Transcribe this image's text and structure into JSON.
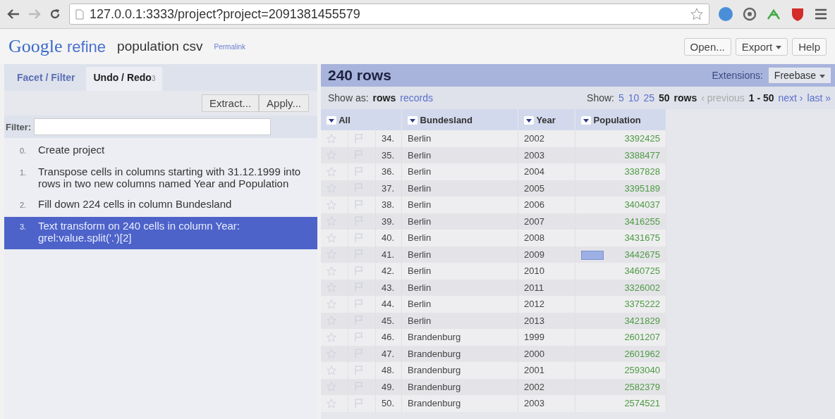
{
  "browser": {
    "url": "127.0.0.1:3333/project?project=2091381455579"
  },
  "header": {
    "logo_google": "Google",
    "logo_refine": "refine",
    "project_name": "population csv",
    "permalink": "Permalink",
    "buttons": [
      {
        "label": "Open...",
        "menu": false
      },
      {
        "label": "Export",
        "menu": true
      },
      {
        "label": "Help",
        "menu": false
      }
    ]
  },
  "left_panel": {
    "tabs": [
      {
        "label": "Facet / Filter",
        "selected": false
      },
      {
        "label": "Undo / Redo",
        "count": "3",
        "selected": true
      }
    ],
    "actions": [
      "Extract...",
      "Apply..."
    ],
    "filter_label": "Filter:",
    "history": [
      {
        "index": "0.",
        "text": "Create project",
        "selected": false
      },
      {
        "index": "1.",
        "text": "Transpose cells in columns starting with 31.12.1999 into rows in two new columns named Year and Population",
        "selected": false
      },
      {
        "index": "2.",
        "text": "Fill down 224 cells in column Bundesland",
        "selected": false
      },
      {
        "index": "3.",
        "text": "Text transform on 240 cells in column Year: grel:value.split('.')[2]",
        "selected": true
      }
    ]
  },
  "grid": {
    "row_count": "240 rows",
    "extensions_label": "Extensions:",
    "extension_menu": "Freebase",
    "show_as_label": "Show as:",
    "modes": [
      {
        "label": "rows",
        "selected": true
      },
      {
        "label": "records",
        "selected": false
      }
    ],
    "show_label": "Show:",
    "page_sizes": [
      {
        "label": "5",
        "selected": false
      },
      {
        "label": "10",
        "selected": false
      },
      {
        "label": "25",
        "selected": false
      },
      {
        "label": "50",
        "selected": true
      }
    ],
    "page_size_unit": "rows",
    "pager": {
      "previous": "‹ previous",
      "previous_disabled": true,
      "range": "1 - 50",
      "next": "next ›",
      "last": "last »"
    },
    "columns": [
      "All",
      "Bundesland",
      "Year",
      "Population"
    ],
    "rows": [
      {
        "index": "34.",
        "bundesland": "Berlin",
        "year": "2002",
        "population": "3392425",
        "hovered": false
      },
      {
        "index": "35.",
        "bundesland": "Berlin",
        "year": "2003",
        "population": "3388477",
        "hovered": false
      },
      {
        "index": "36.",
        "bundesland": "Berlin",
        "year": "2004",
        "population": "3387828",
        "hovered": false
      },
      {
        "index": "37.",
        "bundesland": "Berlin",
        "year": "2005",
        "population": "3395189",
        "hovered": false
      },
      {
        "index": "38.",
        "bundesland": "Berlin",
        "year": "2006",
        "population": "3404037",
        "hovered": false
      },
      {
        "index": "39.",
        "bundesland": "Berlin",
        "year": "2007",
        "population": "3416255",
        "hovered": false
      },
      {
        "index": "40.",
        "bundesland": "Berlin",
        "year": "2008",
        "population": "3431675",
        "hovered": false
      },
      {
        "index": "41.",
        "bundesland": "Berlin",
        "year": "2009",
        "population": "3442675",
        "hovered": true
      },
      {
        "index": "42.",
        "bundesland": "Berlin",
        "year": "2010",
        "population": "3460725",
        "hovered": false
      },
      {
        "index": "43.",
        "bundesland": "Berlin",
        "year": "2011",
        "population": "3326002",
        "hovered": false
      },
      {
        "index": "44.",
        "bundesland": "Berlin",
        "year": "2012",
        "population": "3375222",
        "hovered": false
      },
      {
        "index": "45.",
        "bundesland": "Berlin",
        "year": "2013",
        "population": "3421829",
        "hovered": false
      },
      {
        "index": "46.",
        "bundesland": "Brandenburg",
        "year": "1999",
        "population": "2601207",
        "hovered": false
      },
      {
        "index": "47.",
        "bundesland": "Brandenburg",
        "year": "2000",
        "population": "2601962",
        "hovered": false
      },
      {
        "index": "48.",
        "bundesland": "Brandenburg",
        "year": "2001",
        "population": "2593040",
        "hovered": false
      },
      {
        "index": "49.",
        "bundesland": "Brandenburg",
        "year": "2002",
        "population": "2582379",
        "hovered": false
      },
      {
        "index": "50.",
        "bundesland": "Brandenburg",
        "year": "2003",
        "population": "2574521",
        "hovered": false
      }
    ]
  }
}
